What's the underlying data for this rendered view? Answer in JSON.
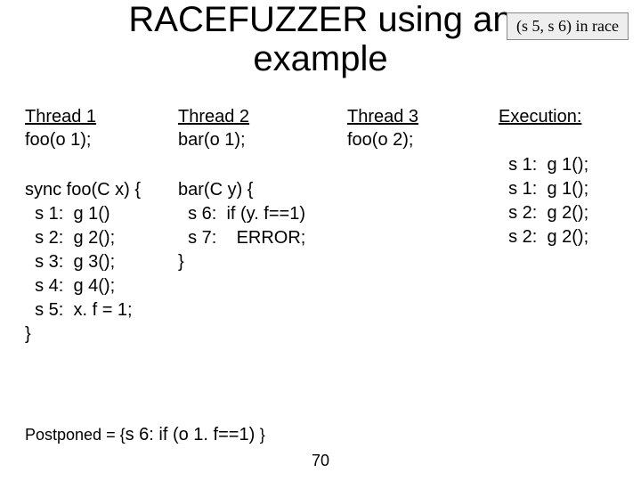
{
  "title_line1": "RACEFUZZER using an",
  "title_line2": "example",
  "race_badge": "(s 5, s 6) in race",
  "col1_hdr": "Thread 1",
  "col1_call": "foo(o 1);",
  "col2_hdr": "Thread 2",
  "col2_call": "bar(o 1);",
  "col3_hdr": "Thread 3",
  "col3_call": "foo(o 2);",
  "col4_hdr": "Execution:",
  "foo_code": "sync foo(C x) {\n  s 1:  g 1()\n  s 2:  g 2();\n  s 3:  g 3();\n  s 4:  g 4();\n  s 5:  x. f = 1;\n}",
  "bar_code": "bar(C y) {\n  s 6:  if (y. f==1)\n  s 7:    ERROR;\n}",
  "exec_code": "  s 1:  g 1();\n  s 1:  g 1();\n  s 2:  g 2();\n  s 2:  g 2();",
  "postponed_label": "Postponed = {",
  "postponed_body": "s 6:  if (o 1. f==1) ",
  "postponed_close": "}",
  "page_number": "70"
}
